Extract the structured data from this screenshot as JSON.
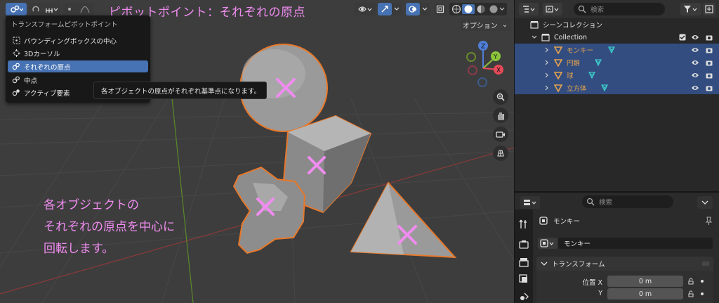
{
  "viewport": {
    "overlay_title": "ピボットポイント：それぞれの原点",
    "options_label": "オプション",
    "options_chevron": "⌄",
    "caption_lines": [
      "各オブジェクトの",
      "それぞれの原点を中心に",
      "回転します。"
    ]
  },
  "pivot_menu": {
    "title": "トランスフォームピボットポイント",
    "items": [
      {
        "label": "バウンディングボックスの中心",
        "icon": "bounding-box-center-icon",
        "selected": false
      },
      {
        "label": "3Dカーソル",
        "icon": "cursor-3d-icon",
        "selected": false
      },
      {
        "label": "それぞれの原点",
        "icon": "individual-origins-icon",
        "selected": true
      },
      {
        "label": "中点",
        "icon": "median-point-icon",
        "selected": false
      },
      {
        "label": "アクティブ要素",
        "icon": "active-element-icon",
        "selected": false
      }
    ],
    "tooltip": "各オブジェクトの原点がそれぞれ基準点になります。"
  },
  "gizmo": {
    "x": "X",
    "y": "Y",
    "z": "Z"
  },
  "outliner": {
    "search_placeholder": "検索",
    "scene_collection": "シーンコレクション",
    "collection": "Collection",
    "objects": [
      {
        "name": "モンキー"
      },
      {
        "name": "円錐"
      },
      {
        "name": "球"
      },
      {
        "name": "立方体"
      }
    ]
  },
  "properties": {
    "search_placeholder": "検索",
    "object_name": "モンキー",
    "datablock_name": "モンキー",
    "section_title": "トランスフォーム",
    "location_label": "位置 X",
    "y_label": "Y",
    "location_x": "0 m",
    "location_y": "0 m"
  },
  "colors": {
    "accent": "#4772b3",
    "overlay_pink": "#f08cf0",
    "selection_outline": "#e8782a",
    "object_orange": "#e6a34d",
    "mesh_teal": "#3ec9c9"
  }
}
